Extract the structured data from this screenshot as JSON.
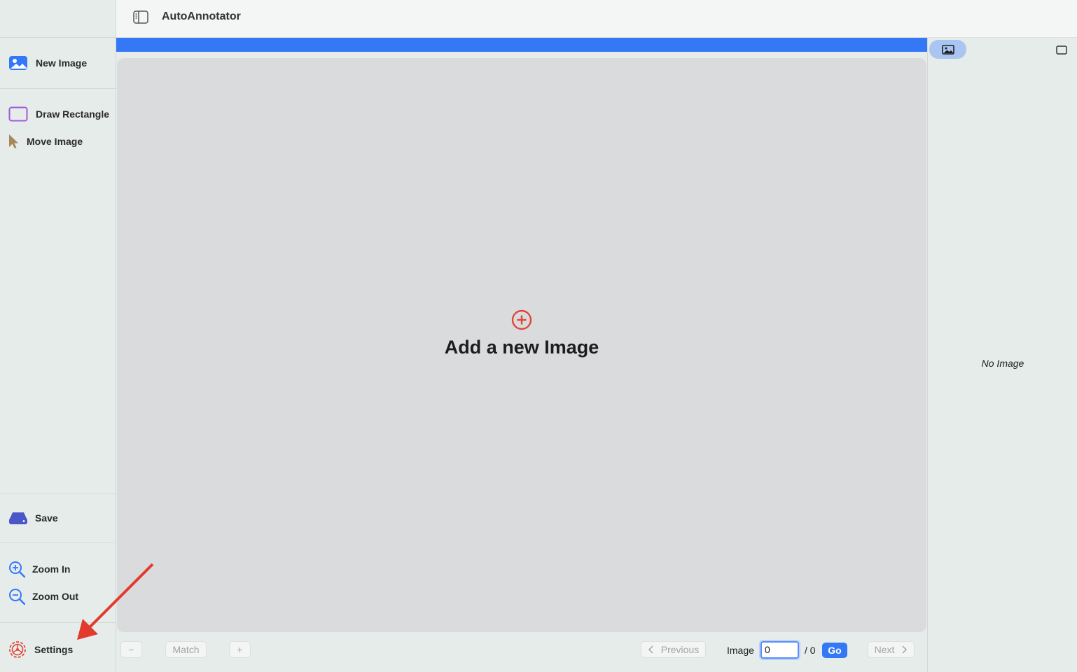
{
  "app": {
    "title": "AutoAnnotator"
  },
  "sidebar": {
    "new_image": "New Image",
    "draw_rectangle": "Draw Rectangle",
    "move_image": "Move Image",
    "save": "Save",
    "zoom_in": "Zoom In",
    "zoom_out": "Zoom Out",
    "settings": "Settings"
  },
  "canvas": {
    "empty_label": "Add a new Image"
  },
  "right_panel": {
    "empty_label": "No Image"
  },
  "bottom_bar": {
    "zoom_minus": "−",
    "match": "Match",
    "zoom_plus": "+",
    "previous": "Previous",
    "image_label": "Image",
    "image_index_value": "0",
    "total": "/ 0",
    "go": "Go",
    "next": "Next"
  },
  "colors": {
    "accent": "#3478f6",
    "plus_red": "#e0473a",
    "annotation_arrow": "#e23b2e",
    "draw_rect_purple": "#a05ad8",
    "move_brown": "#a8875a",
    "save_indigo": "#4a55c8"
  }
}
